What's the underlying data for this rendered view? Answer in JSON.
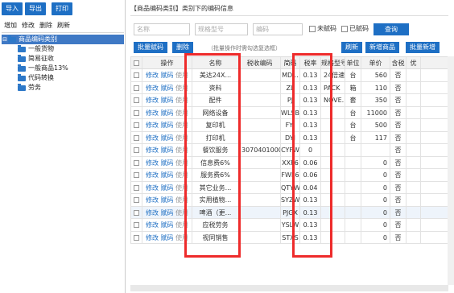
{
  "toolbar": {
    "import": "导入",
    "export": "导出",
    "print": "打印"
  },
  "tree_actions": {
    "add": "增加",
    "edit": "修改",
    "delete": "删除",
    "refresh": "刷新"
  },
  "tree": {
    "root": "商品编码类别",
    "root_toggle": "⊟",
    "children": [
      "一般货物",
      "简易征收",
      "一般商品13%",
      "代码转换",
      "劳务"
    ]
  },
  "panel_title": "【商品编码类别】类别下的编码信息",
  "search": {
    "name_placeholder": "名称",
    "spec_placeholder": "规格型号",
    "code_placeholder": "编码",
    "unassigned": "未赋码",
    "assigned": "已赋码",
    "query": "查询"
  },
  "actions": {
    "batch_assign": "批量赋码",
    "delete": "删除",
    "hint": "（批量操作时需勾选复选框）",
    "refresh": "刷新",
    "add_item": "新增商品",
    "batch_add": "批量新增"
  },
  "table": {
    "headers": [
      "",
      "操作",
      "名称",
      "税收编码",
      "简码",
      "税率",
      "规格型号",
      "单位",
      "单价",
      "含税",
      "优"
    ],
    "op_links": [
      "修改",
      "赋码",
      "使用"
    ],
    "rows": [
      {
        "name": "美达24X...",
        "tax_code": "",
        "short": "MD...",
        "rate": "0.13",
        "spec": "24倍速",
        "unit": "台",
        "price": "560",
        "tax": "否"
      },
      {
        "name": "资料",
        "tax_code": "",
        "short": "ZL",
        "rate": "0.13",
        "spec": "PACK",
        "unit": "箱",
        "price": "110",
        "tax": "否"
      },
      {
        "name": "配件",
        "tax_code": "",
        "short": "PJ",
        "rate": "0.13",
        "spec": "NOVE...",
        "unit": "套",
        "price": "350",
        "tax": "否"
      },
      {
        "name": "网络设备",
        "tax_code": "",
        "short": "WLSB",
        "rate": "0.13",
        "spec": "",
        "unit": "台",
        "price": "11000",
        "tax": "否"
      },
      {
        "name": "复印机",
        "tax_code": "",
        "short": "FYJ",
        "rate": "0.13",
        "spec": "",
        "unit": "台",
        "price": "500",
        "tax": "否"
      },
      {
        "name": "打印机",
        "tax_code": "",
        "short": "DYJ",
        "rate": "0.13",
        "spec": "",
        "unit": "台",
        "price": "117",
        "tax": "否"
      },
      {
        "name": "餐饮服务",
        "tax_code": "3070401000...",
        "short": "CYFW",
        "rate": "0",
        "spec": "",
        "unit": "",
        "price": "",
        "tax": "否"
      },
      {
        "name": "信息费6%",
        "tax_code": "",
        "short": "XXF6",
        "rate": "0.06",
        "spec": "",
        "unit": "",
        "price": "0",
        "tax": "否"
      },
      {
        "name": "服务费6%",
        "tax_code": "",
        "short": "FWF6",
        "rate": "0.06",
        "spec": "",
        "unit": "",
        "price": "0",
        "tax": "否"
      },
      {
        "name": "其它业务...",
        "tax_code": "",
        "short": "QTYW",
        "rate": "0.04",
        "spec": "",
        "unit": "",
        "price": "0",
        "tax": "否"
      },
      {
        "name": "实用植物...",
        "tax_code": "",
        "short": "SYZW",
        "rate": "0.13",
        "spec": "",
        "unit": "",
        "price": "0",
        "tax": "否"
      },
      {
        "name": "啤酒（更...",
        "tax_code": "",
        "short": "PJGX",
        "rate": "0.13",
        "spec": "",
        "unit": "",
        "price": "0",
        "tax": "否"
      },
      {
        "name": "应税劳务",
        "tax_code": "",
        "short": "YSLW",
        "rate": "0.13",
        "spec": "",
        "unit": "",
        "price": "0",
        "tax": "否"
      },
      {
        "name": "视同销售",
        "tax_code": "",
        "short": "STXS",
        "rate": "0.13",
        "spec": "",
        "unit": "",
        "price": "0",
        "tax": "否"
      }
    ]
  },
  "colors": {
    "accent": "#1e6fc4",
    "highlight": "#ee2b2b"
  }
}
